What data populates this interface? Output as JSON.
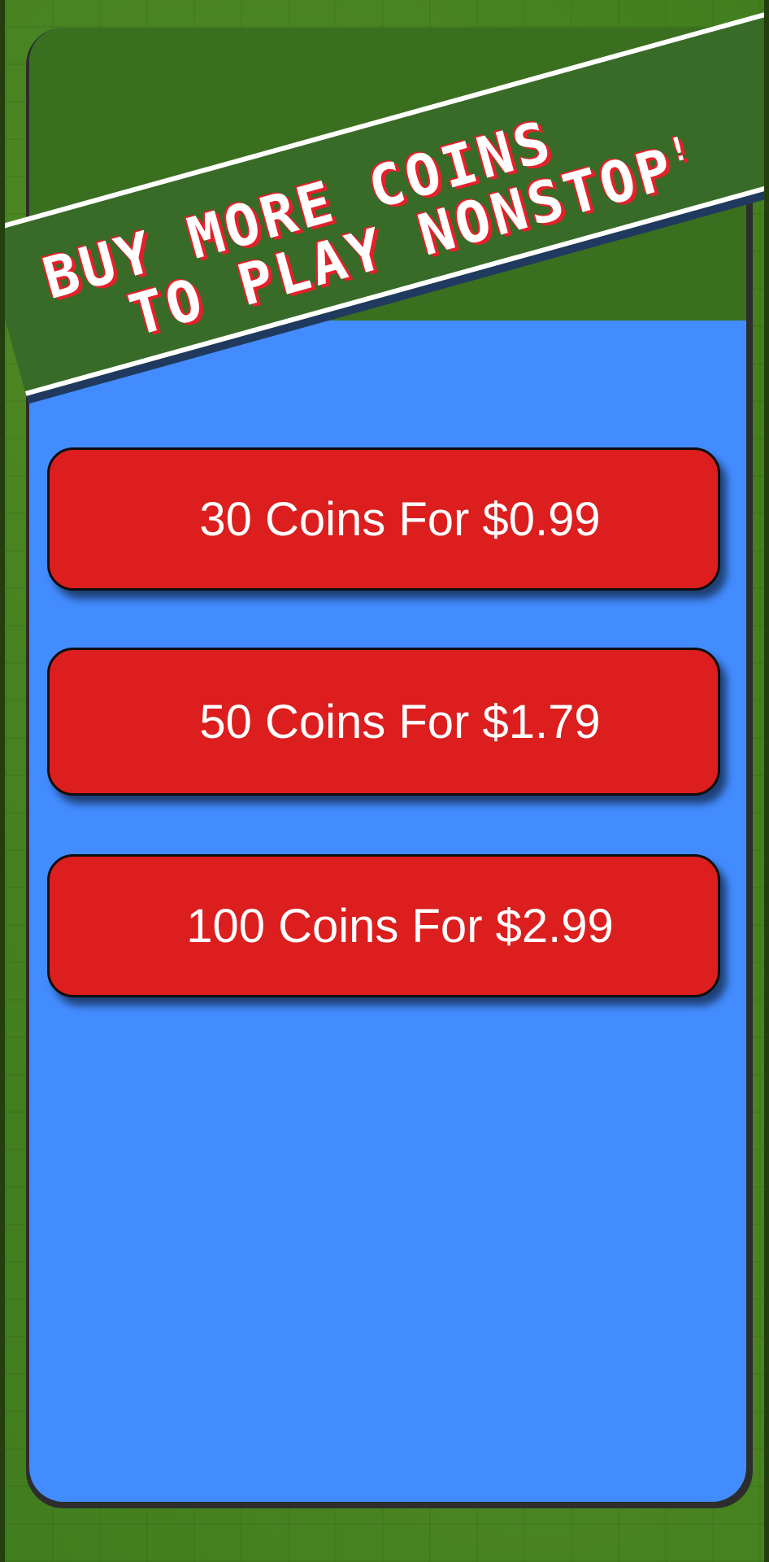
{
  "banner": {
    "line1": "BUY MORE COINS",
    "line2": "TO PLAY NONSTOP",
    "exclamation": "!"
  },
  "offers": [
    {
      "label": "30 Coins For $0.99"
    },
    {
      "label": "50 Coins For $1.79"
    },
    {
      "label": "100 Coins For $2.99"
    }
  ],
  "colors": {
    "panel": "#438cff",
    "button": "#dc1e1e",
    "banner": "#376b27",
    "banner_text_shadow": "#e5202a",
    "background": "#3c7a1a"
  }
}
